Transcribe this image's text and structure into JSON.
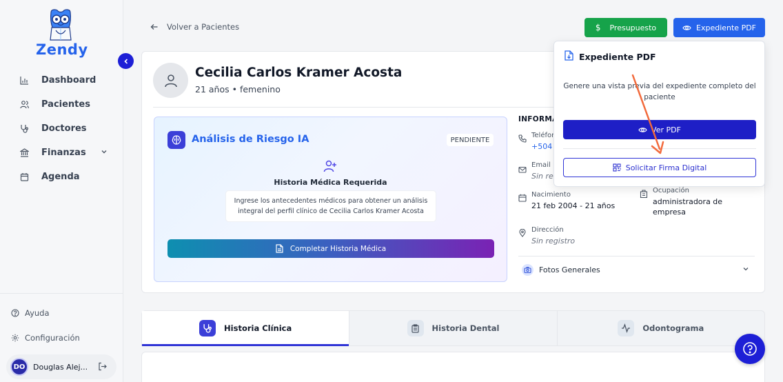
{
  "brand": {
    "name": "Zendy",
    "accent": "#2563eb"
  },
  "sidebar": {
    "items": [
      {
        "label": "Dashboard",
        "icon": "bar-chart-icon"
      },
      {
        "label": "Pacientes",
        "icon": "users-icon"
      },
      {
        "label": "Doctores",
        "icon": "stethoscope-icon"
      },
      {
        "label": "Finanzas",
        "icon": "bank-icon"
      },
      {
        "label": "Agenda",
        "icon": "calendar-icon"
      }
    ],
    "footer": {
      "help": "Ayuda",
      "settings": "Configuración"
    },
    "user": {
      "initials": "DO",
      "name": "Douglas Alej..."
    }
  },
  "header": {
    "back_label": "Volver a Pacientes",
    "presupuesto_label": "Presupuesto",
    "presupuesto_symbol": "$",
    "pdf_label": "Expediente PDF"
  },
  "patient": {
    "name": "Cecilia Carlos Kramer Acosta",
    "subtitle": "21 años • femenino"
  },
  "risk": {
    "title": "Análisis de Riesgo IA",
    "status": "PENDIENTE",
    "required_title": "Historia Médica Requerida",
    "required_text_1": "Ingrese los antecedentes médicos para obtener un análisis",
    "required_text_2": "integral del perfil clínico de Cecilia Carlos Kramer Acosta",
    "button_label": "Completar Historia Médica"
  },
  "info": {
    "heading": "INFORMACIÓN",
    "phone_label": "Teléfono",
    "phone_value": "+504",
    "email_label": "Email",
    "email_value": "Sin registro",
    "birth_label": "Nacimiento",
    "birth_value": "21 feb 2004 - 21 años",
    "occupation_label": "Ocupación",
    "occupation_value_1": "administradora de",
    "occupation_value_2": "empresa",
    "address_label": "Dirección",
    "address_value": "Sin registro",
    "photos_label": "Fotos Generales"
  },
  "tabs": [
    {
      "label": "Historia Clínica",
      "active": true
    },
    {
      "label": "Historia Dental",
      "active": false
    },
    {
      "label": "Odontograma",
      "active": false
    }
  ],
  "popover": {
    "title": "Expediente PDF",
    "description": "Genere una vista previa del expediente completo del paciente",
    "view_label": "Ver PDF",
    "sign_label": "Solicitar Firma Digital"
  }
}
